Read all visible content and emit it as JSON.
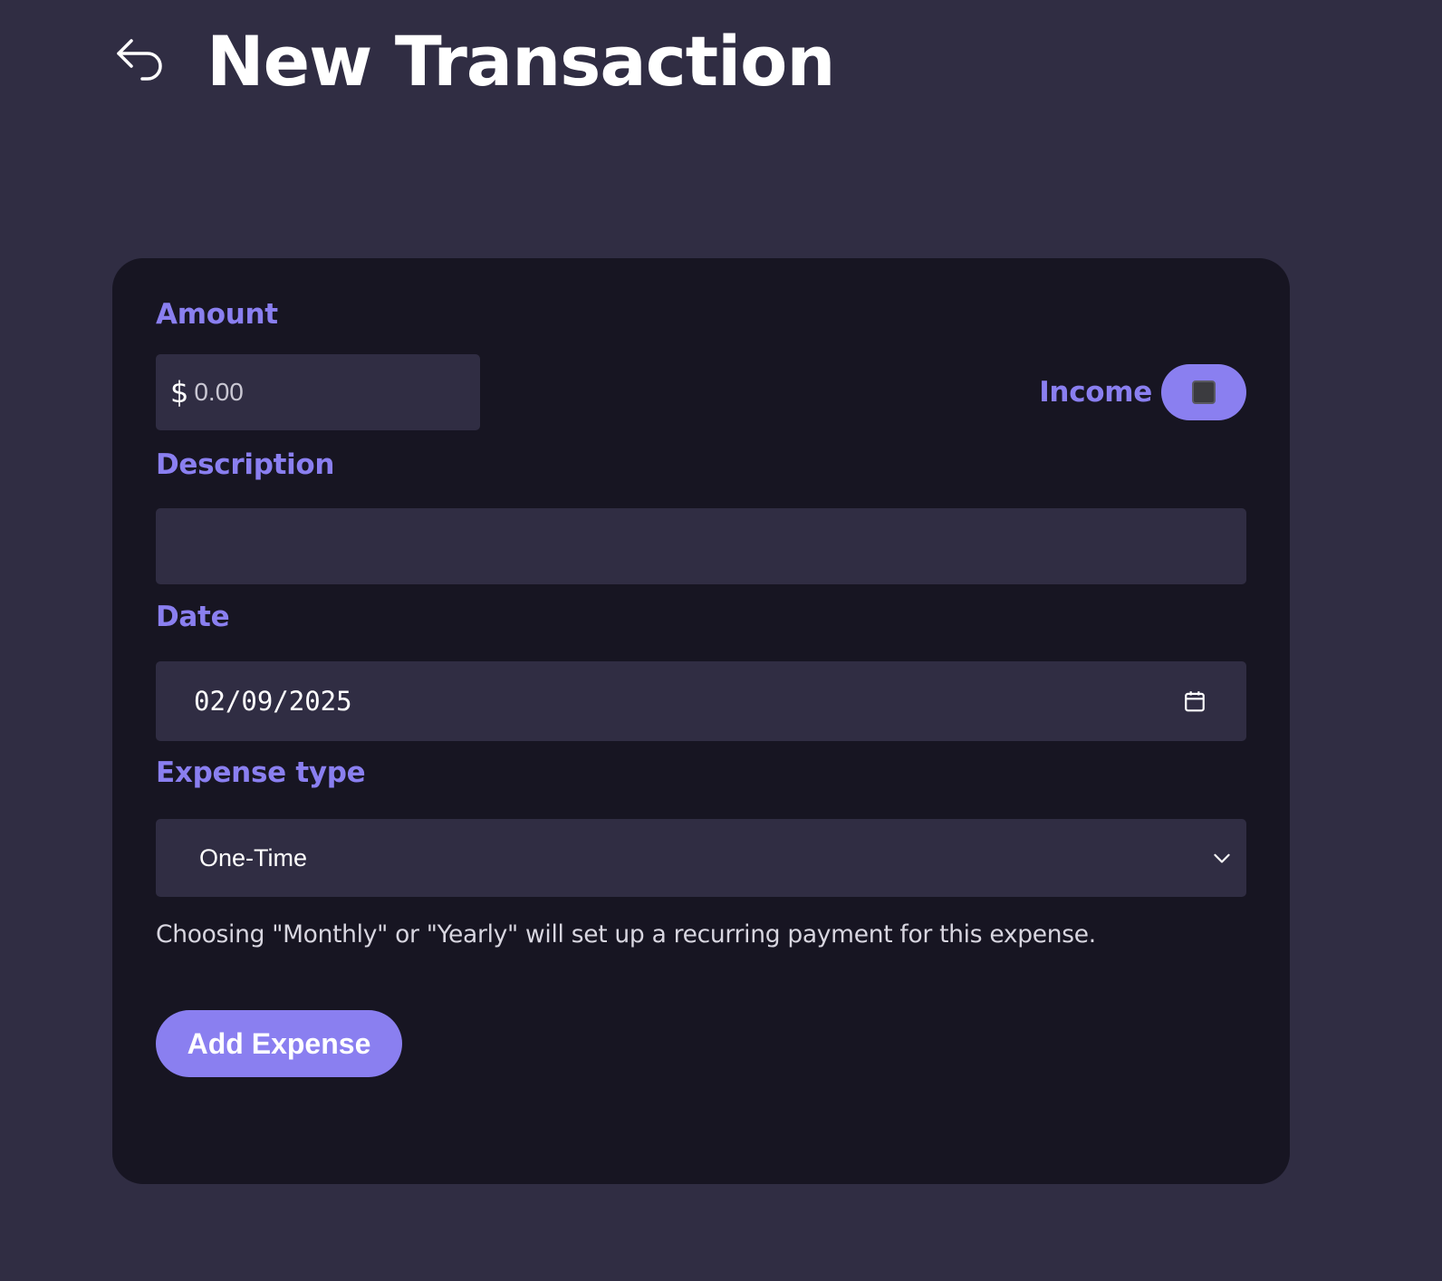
{
  "header": {
    "title": "New Transaction",
    "back_icon": "back-arrow-icon"
  },
  "form": {
    "amount": {
      "label": "Amount",
      "currency_symbol": "$",
      "placeholder": "0.00",
      "value": ""
    },
    "income": {
      "label": "Income",
      "checked": false
    },
    "description": {
      "label": "Description",
      "value": ""
    },
    "date": {
      "label": "Date",
      "value": "02/09/2025",
      "icon": "calendar-icon"
    },
    "expense_type": {
      "label": "Expense type",
      "selected": "One-Time",
      "icon": "chevron-down-icon"
    },
    "helper_text": "Choosing \"Monthly\" or \"Yearly\" will set up a recurring payment for this expense.",
    "submit_label": "Add Expense"
  },
  "colors": {
    "background": "#302d43",
    "card": "#171522",
    "accent": "#8a7ff0",
    "text": "#ffffff"
  }
}
